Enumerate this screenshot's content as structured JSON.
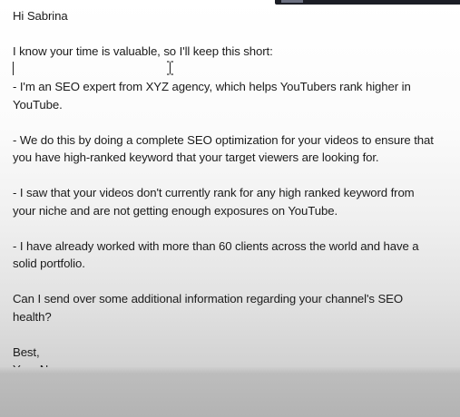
{
  "email": {
    "greeting": "Hi Sabrina",
    "intro": "I know your time is valuable, so I'll keep this short:",
    "point1": "- I'm an SEO expert from XYZ agency, which helps YouTubers rank higher in YouTube.",
    "point2": "- We do this by doing a complete SEO optimization for your videos to ensure that you have high-ranked keyword that your target viewers are looking for.",
    "point3": "- I saw that your videos don't currently rank for any high ranked keyword from your niche and are not getting enough exposures on YouTube.",
    "point4": "- I have already worked with more than 60 clients across the world and have a solid portfolio.",
    "question": "Can I send over some additional information regarding your channel's SEO health?",
    "signoff": "Best,",
    "signature": "Your Name"
  },
  "icons": {
    "cursor": "text-cursor-icon",
    "caret": "text-caret"
  }
}
